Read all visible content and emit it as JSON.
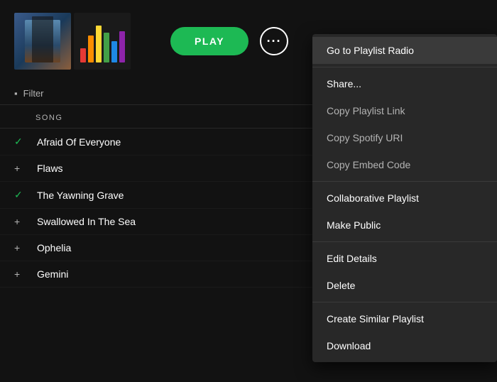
{
  "header": {
    "play_label": "PLAY",
    "more_label": "···"
  },
  "filter": {
    "icon": "▪",
    "label": "Filter"
  },
  "song_list": {
    "column_header": "SONG",
    "items": [
      {
        "icon": "✓",
        "icon_type": "check",
        "title": "Afraid Of Everyone"
      },
      {
        "icon": "+",
        "icon_type": "plus",
        "title": "Flaws"
      },
      {
        "icon": "✓",
        "icon_type": "check",
        "title": "The Yawning Grave"
      },
      {
        "icon": "+",
        "icon_type": "plus",
        "title": "Swallowed In The Sea"
      },
      {
        "icon": "+",
        "icon_type": "plus",
        "title": "Ophelia"
      },
      {
        "icon": "+",
        "icon_type": "plus",
        "title": "Gemini"
      }
    ]
  },
  "context_menu": {
    "items": [
      {
        "id": "go-to-playlist-radio",
        "label": "Go to Playlist Radio",
        "type": "primary",
        "divider_after": false
      },
      {
        "id": "share",
        "label": "Share...",
        "type": "section-header",
        "divider_before": true,
        "divider_after": false
      },
      {
        "id": "copy-playlist-link",
        "label": "Copy Playlist Link",
        "type": "sub",
        "divider_after": false
      },
      {
        "id": "copy-spotify-uri",
        "label": "Copy Spotify URI",
        "type": "sub",
        "divider_after": false
      },
      {
        "id": "copy-embed-code",
        "label": "Copy Embed Code",
        "type": "sub",
        "divider_after": true
      },
      {
        "id": "collaborative-playlist",
        "label": "Collaborative Playlist",
        "type": "primary",
        "divider_after": false
      },
      {
        "id": "make-public",
        "label": "Make Public",
        "type": "primary",
        "divider_after": true
      },
      {
        "id": "edit-details",
        "label": "Edit Details",
        "type": "primary",
        "divider_after": false
      },
      {
        "id": "delete",
        "label": "Delete",
        "type": "primary",
        "divider_after": true
      },
      {
        "id": "create-similar-playlist",
        "label": "Create Similar Playlist",
        "type": "primary",
        "divider_after": false
      },
      {
        "id": "download",
        "label": "Download",
        "type": "primary",
        "divider_after": false
      }
    ]
  },
  "colors": {
    "accent": "#1db954",
    "background": "#121212",
    "menu_bg": "#282828",
    "text_primary": "#ffffff",
    "text_secondary": "#b3b3b3"
  }
}
